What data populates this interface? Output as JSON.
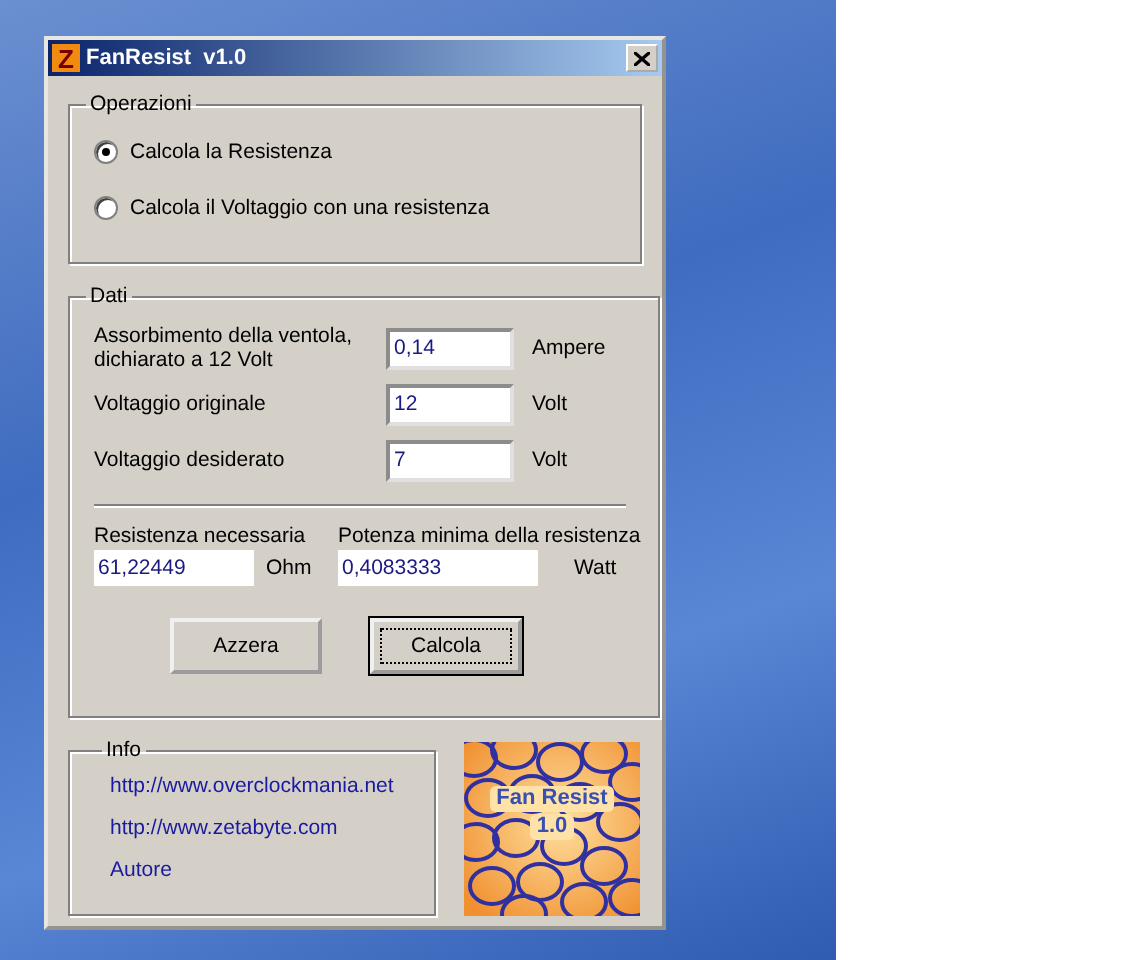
{
  "window": {
    "title": "FanResist  v1.0",
    "icon": "Z"
  },
  "operations": {
    "legend": "Operazioni",
    "options": [
      {
        "label": "Calcola la Resistenza",
        "selected": true
      },
      {
        "label": "Calcola il Voltaggio con una resistenza",
        "selected": false
      }
    ]
  },
  "data": {
    "legend": "Dati",
    "inputs": [
      {
        "label": "Assorbimento della ventola, dichiarato a 12 Volt",
        "value": "0,14",
        "unit": "Ampere"
      },
      {
        "label": "Voltaggio originale",
        "value": "12",
        "unit": "Volt"
      },
      {
        "label": "Voltaggio desiderato",
        "value": "7",
        "unit": "Volt"
      }
    ],
    "outputs": [
      {
        "label": "Resistenza necessaria",
        "value": "61,22449",
        "unit": "Ohm"
      },
      {
        "label": "Potenza minima della resistenza",
        "value": "0,4083333",
        "unit": "Watt"
      }
    ],
    "buttons": [
      {
        "label": "Azzera",
        "focused": false
      },
      {
        "label": "Calcola",
        "focused": true
      }
    ]
  },
  "info": {
    "legend": "Info",
    "links": [
      "http://www.overclockmania.net",
      "http://www.zetabyte.com",
      "Autore"
    ]
  },
  "logo": {
    "title": "Fan Resist",
    "version": "1.0"
  }
}
